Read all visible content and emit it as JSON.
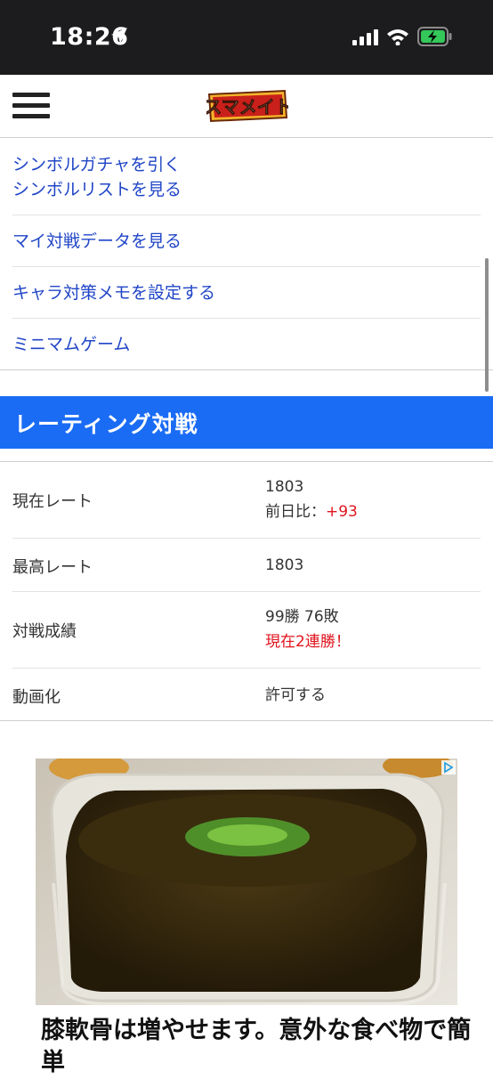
{
  "status_bar": {
    "time": "18:26"
  },
  "header": {
    "logo_text": "スマメイト"
  },
  "menu": {
    "items": [
      {
        "label": "シンボルガチャを引く"
      },
      {
        "label": "シンボルリストを見る"
      },
      {
        "label": "マイ対戦データを見る"
      },
      {
        "label": "キャラ対策メモを設定する"
      },
      {
        "label": "ミニマムゲーム"
      }
    ]
  },
  "section": {
    "title": "レーティング対戦"
  },
  "stats": {
    "current_rate": {
      "label": "現在レート",
      "value": "1803",
      "diff_prefix": "前日比：",
      "diff_value": "+93"
    },
    "max_rate": {
      "label": "最高レート",
      "value": "1803"
    },
    "record": {
      "label": "対戦成績",
      "value": "99勝 76敗",
      "streak": "現在2連勝！"
    },
    "video": {
      "label": "動画化",
      "value": "許可する"
    }
  },
  "ad": {
    "headline": "膝軟骨は増やせます。意外な食べ物で簡単"
  },
  "colors": {
    "accent": "#1a6cf5",
    "link": "#2146c7",
    "red": "#e0141e",
    "statusbar": "#1c1c1e"
  }
}
